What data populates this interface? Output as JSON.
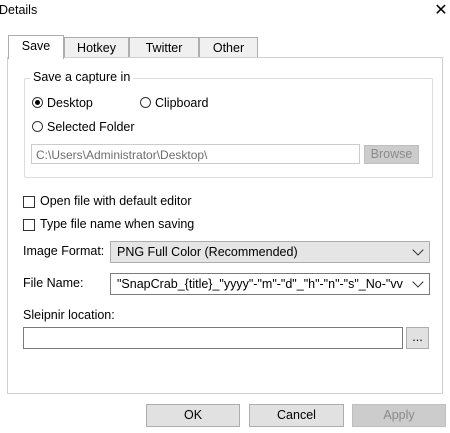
{
  "window": {
    "title": "Details",
    "close_glyph": "✕"
  },
  "tabs": [
    {
      "label": "Save",
      "active": true
    },
    {
      "label": "Hotkey",
      "active": false
    },
    {
      "label": "Twitter",
      "active": false
    },
    {
      "label": "Other",
      "active": false
    }
  ],
  "capture_group": {
    "legend": "Save a capture in",
    "desktop_label": "Desktop",
    "clipboard_label": "Clipboard",
    "folder_label": "Selected Folder",
    "selected": "Desktop",
    "folder_path": "C:\\Users\\Administrator\\Desktop\\",
    "browse_label": "Browse"
  },
  "options": {
    "open_editor_label": "Open file with default editor",
    "open_editor_checked": false,
    "type_name_label": "Type file name when saving",
    "type_name_checked": false
  },
  "image_format": {
    "label": "Image Format:",
    "value": "PNG Full Color (Recommended)"
  },
  "file_name": {
    "label": "File Name:",
    "value": "\"SnapCrab_{title}_\"yyyy\"-\"m\"-\"d\"_\"h\"-\"n\"-\"s\"_No-\"vv"
  },
  "sleipnir": {
    "label": "Sleipnir location:",
    "value": "",
    "browse_glyph": "..."
  },
  "footer": {
    "ok_label": "OK",
    "cancel_label": "Cancel",
    "apply_label": "Apply"
  }
}
